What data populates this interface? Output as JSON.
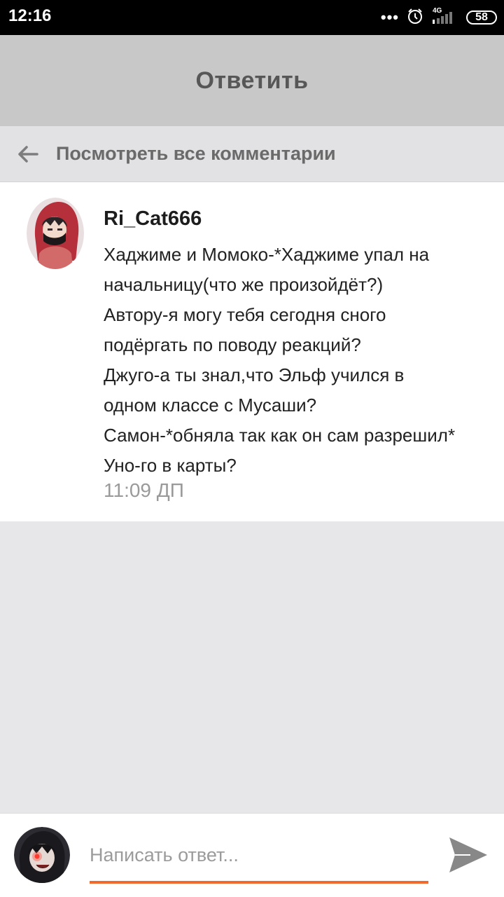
{
  "status_bar": {
    "time": "12:16",
    "dots": "•••",
    "network": "4G",
    "battery": "58"
  },
  "topbar": {
    "title": "Ответить"
  },
  "view_all": {
    "label": "Посмотреть все комментарии"
  },
  "comment": {
    "username": "Ri_Cat666",
    "lines": [
      "Хаджиме и Момоко-*Хаджиме упал на",
      "начальницу(что же произойдёт?)",
      "Автору-я могу тебя сегодня сного",
      "подёргать по поводу реакций?",
      "Джуго-а ты знал,что Эльф учился в",
      "одном классе с Мусаши?",
      "Самон-*обняла так как он сам разрешил*",
      "Уно-го в карты?"
    ],
    "time": "11:09 ДП"
  },
  "reply": {
    "placeholder": "Написать ответ...",
    "value": ""
  },
  "colors": {
    "accent": "#f26a2e",
    "header": "#c8c8c8",
    "background": "#e7e6e9"
  },
  "icons": {
    "back": "arrow-left-icon",
    "send": "send-icon",
    "alarm": "alarm-clock-icon",
    "signal": "signal-icon"
  }
}
